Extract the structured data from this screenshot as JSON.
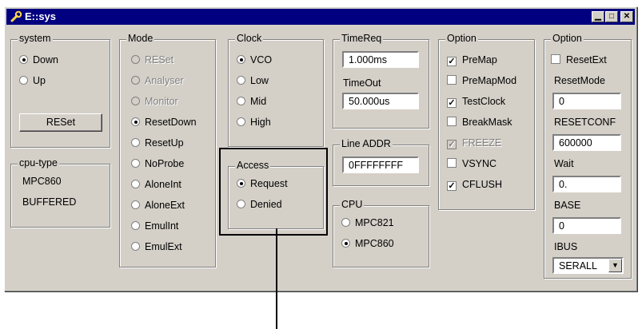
{
  "window": {
    "title": "E::sys"
  },
  "system": {
    "label": "system",
    "options": [
      "Down",
      "Up"
    ],
    "selected": "Down",
    "reset_button": "RESet"
  },
  "cpu_type": {
    "label": "cpu-type",
    "lines": [
      "MPC860",
      "BUFFERED"
    ]
  },
  "mode": {
    "label": "Mode",
    "options": [
      "RESet",
      "Analyser",
      "Monitor",
      "ResetDown",
      "ResetUp",
      "NoProbe",
      "AloneInt",
      "AloneExt",
      "EmulInt",
      "EmulExt"
    ],
    "selected": "ResetDown",
    "disabled": [
      "RESet",
      "Analyser",
      "Monitor"
    ]
  },
  "clock": {
    "label": "Clock",
    "options": [
      "VCO",
      "Low",
      "Mid",
      "High"
    ],
    "selected": "VCO"
  },
  "access": {
    "label": "Access",
    "options": [
      "Request",
      "Denied"
    ],
    "selected": "Request"
  },
  "timereq": {
    "label": "TimeReq",
    "value": "1.000ms"
  },
  "timeout": {
    "label": "TimeOut",
    "value": "50.000us"
  },
  "line_addr": {
    "label": "Line ADDR",
    "value": "0FFFFFFFF"
  },
  "cpu": {
    "label": "CPU",
    "options": [
      "MPC821",
      "MPC860"
    ],
    "selected": "MPC860"
  },
  "option1": {
    "label": "Option",
    "items": [
      "PreMap",
      "PreMapMod",
      "TestClock",
      "BreakMask",
      "FREEZE",
      "VSYNC",
      "CFLUSH"
    ],
    "checked": [
      "PreMap",
      "TestClock",
      "FREEZE",
      "CFLUSH"
    ],
    "disabled": [
      "FREEZE"
    ]
  },
  "option2": {
    "label": "Option",
    "resetext": "ResetExt",
    "resetmode": {
      "label": "ResetMode",
      "value": "0"
    },
    "resetconf": {
      "label": "RESETCONF",
      "value": "600000"
    },
    "wait": {
      "label": "Wait",
      "value": "0."
    },
    "base": {
      "label": "BASE",
      "value": "0"
    },
    "ibus": {
      "label": "IBUS",
      "value": "SERALL"
    }
  }
}
